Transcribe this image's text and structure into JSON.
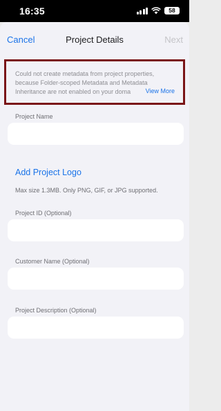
{
  "status_bar": {
    "time": "16:35",
    "battery": "58"
  },
  "nav": {
    "cancel": "Cancel",
    "title": "Project Details",
    "next": "Next"
  },
  "error": {
    "line1": "Could not create metadata from project properties,",
    "line2": "because Folder-scoped Metadata and Metadata",
    "line3": "Inheritance are not enabled on your doma",
    "view_more": "View More"
  },
  "form": {
    "project_name_label": "Project Name",
    "project_name_value": "",
    "add_logo": "Add Project Logo",
    "logo_hint": "Max size 1.3MB. Only PNG, GIF, or JPG supported.",
    "project_id_label": "Project ID (Optional)",
    "project_id_value": "",
    "customer_name_label": "Customer Name (Optional)",
    "customer_name_value": "",
    "project_description_label": "Project Description (Optional)",
    "project_description_value": ""
  },
  "colors": {
    "accent": "#1a73e8",
    "error_border": "#7a1518",
    "background": "#f2f2f7"
  },
  "icons": [
    "cellular-signal-icon",
    "wifi-icon",
    "battery-icon"
  ]
}
